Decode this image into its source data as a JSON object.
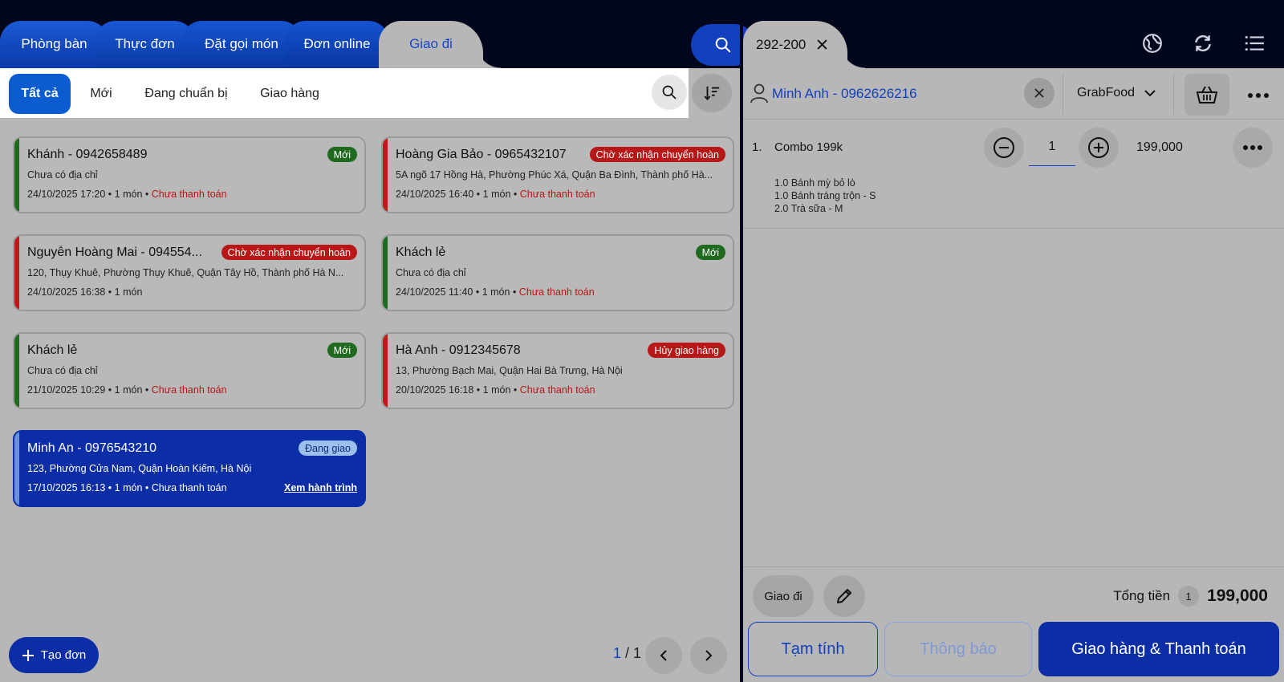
{
  "left_tabs": [
    {
      "label": "Phòng bàn"
    },
    {
      "label": "Thực đơn"
    },
    {
      "label": "Đặt gọi món"
    },
    {
      "label": "Đơn online"
    },
    {
      "label": "Giao đi"
    }
  ],
  "filters": [
    {
      "label": "Tất cả"
    },
    {
      "label": "Mới"
    },
    {
      "label": "Đang chuẩn bị"
    },
    {
      "label": "Giao hàng"
    }
  ],
  "orders": [
    {
      "name": "Khánh - 0942658489",
      "badge": "Mới",
      "address": "Chưa có địa chỉ",
      "time": "24/10/2025 17:20",
      "items": "1 món",
      "payment": "Chưa thanh toán"
    },
    {
      "name": "Hoàng Gia Bảo - 0965432107",
      "badge": "Chờ xác nhận chuyển hoàn",
      "address": "5A ngõ 17 Hồng Hà, Phường Phúc Xá, Quận Ba Đình, Thành phố Hà...",
      "time": "24/10/2025 16:40",
      "items": "1 món",
      "payment": "Chưa thanh toán"
    },
    {
      "name": "Nguyễn Hoàng Mai - 094554...",
      "badge": "Chờ xác nhận chuyển hoàn",
      "address": "120, Thụy Khuê, Phường Thụy Khuê, Quận Tây Hồ, Thành phố Hà N...",
      "time": "24/10/2025 16:38",
      "items": "1 món",
      "payment": ""
    },
    {
      "name": "Khách lẻ",
      "badge": "Mới",
      "address": "Chưa có địa chỉ",
      "time": "24/10/2025 11:40",
      "items": "1 món",
      "payment": "Chưa thanh toán"
    },
    {
      "name": "Khách lẻ",
      "badge": "Mới",
      "address": "Chưa có địa chỉ",
      "time": "21/10/2025 10:29",
      "items": "1 món",
      "payment": "Chưa thanh toán"
    },
    {
      "name": "Hà Anh - 0912345678",
      "badge": "Hủy giao hàng",
      "address": "13, Phường Bạch Mai, Quận Hai Bà Trưng, Hà Nội",
      "time": "20/10/2025 16:18",
      "items": "1 món",
      "payment": "Chưa thanh toán"
    },
    {
      "name": "Minh An - 0976543210",
      "badge": "Đang giao",
      "address": "123, Phường Cửa Nam, Quận Hoàn Kiếm, Hà Nội",
      "time": "17/10/2025 16:13",
      "items": "1 món",
      "payment": "Chưa thanh toán",
      "link": "Xem hành trình"
    }
  ],
  "create_label": "Tạo đơn",
  "pager": {
    "current": "1",
    "sep": " / ",
    "total": "1"
  },
  "order_tab": {
    "label": "292-200"
  },
  "customer": {
    "label": "Minh Anh - 0962626216"
  },
  "channel": {
    "label": "GrabFood"
  },
  "cart_item": {
    "index": "1.",
    "name": "Combo 199k",
    "qty": "1",
    "price": "199,000",
    "subitems": [
      "1.0 Bánh mỳ bỏ lò",
      "1.0 Bánh tráng trộn - S",
      "2.0 Trà sữa - M"
    ]
  },
  "footer": {
    "ship_chip": "Giao đi",
    "total_label": "Tổng tiền",
    "total_count": "1",
    "total_amount": "199,000",
    "btn_temp": "Tạm tính",
    "btn_notify": "Thông báo",
    "btn_pay": "Giao hàng & Thanh toán"
  },
  "colors": {
    "accent": "#1340bf",
    "brand_dark": "#0b2ea6",
    "status_green": "#1f6a1f",
    "status_red": "#b81717"
  }
}
